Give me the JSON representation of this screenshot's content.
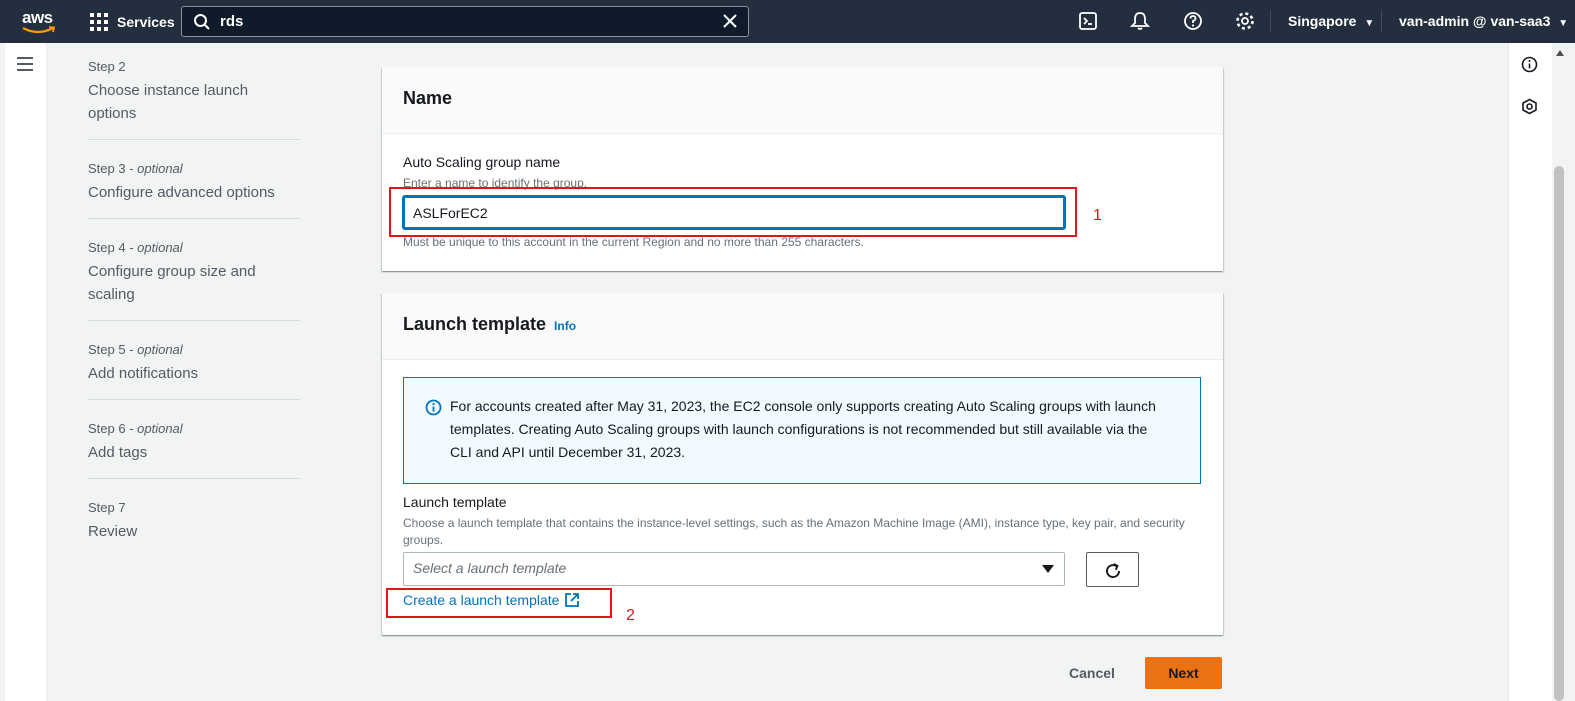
{
  "topnav": {
    "logo": "aws",
    "services_label": "Services",
    "search_value": "rds",
    "region": "Singapore",
    "user": "van-admin @ van-saa3",
    "icons": [
      "cloudshell-icon",
      "notifications-icon",
      "help-icon",
      "settings-icon"
    ]
  },
  "steps": [
    {
      "label": "Step 2",
      "optional": "",
      "title": "Choose instance launch options"
    },
    {
      "label": "Step 3 - ",
      "optional": "optional",
      "title": "Configure advanced options"
    },
    {
      "label": "Step 4 - ",
      "optional": "optional",
      "title": "Configure group size and scaling"
    },
    {
      "label": "Step 5 - ",
      "optional": "optional",
      "title": "Add notifications"
    },
    {
      "label": "Step 6 - ",
      "optional": "optional",
      "title": "Add tags"
    },
    {
      "label": "Step 7",
      "optional": "",
      "title": "Review"
    }
  ],
  "name_panel": {
    "heading": "Name",
    "field_label": "Auto Scaling group name",
    "field_description": "Enter a name to identify the group.",
    "field_value": "ASLForEC2",
    "field_constraint": "Must be unique to this account in the current Region and no more than 255 characters.",
    "annotation": "1"
  },
  "launch_panel": {
    "heading": "Launch template",
    "info_link": "Info",
    "alert_text": "For accounts created after May 31, 2023, the EC2 console only supports creating Auto Scaling groups with launch templates. Creating Auto Scaling groups with launch configurations is not recommended but still available via the CLI and API until December 31, 2023.",
    "field_label": "Launch template",
    "field_description": "Choose a launch template that contains the instance-level settings, such as the Amazon Machine Image (AMI), instance type, key pair, and security groups.",
    "select_placeholder": "Select a launch template",
    "create_link": "Create a launch template",
    "annotation": "2"
  },
  "footer": {
    "cancel_label": "Cancel",
    "next_label": "Next"
  },
  "colors": {
    "topnav_bg": "#232f3e",
    "link": "#0073bb",
    "primary_button": "#ec7211",
    "annotation": "#e0161b"
  }
}
